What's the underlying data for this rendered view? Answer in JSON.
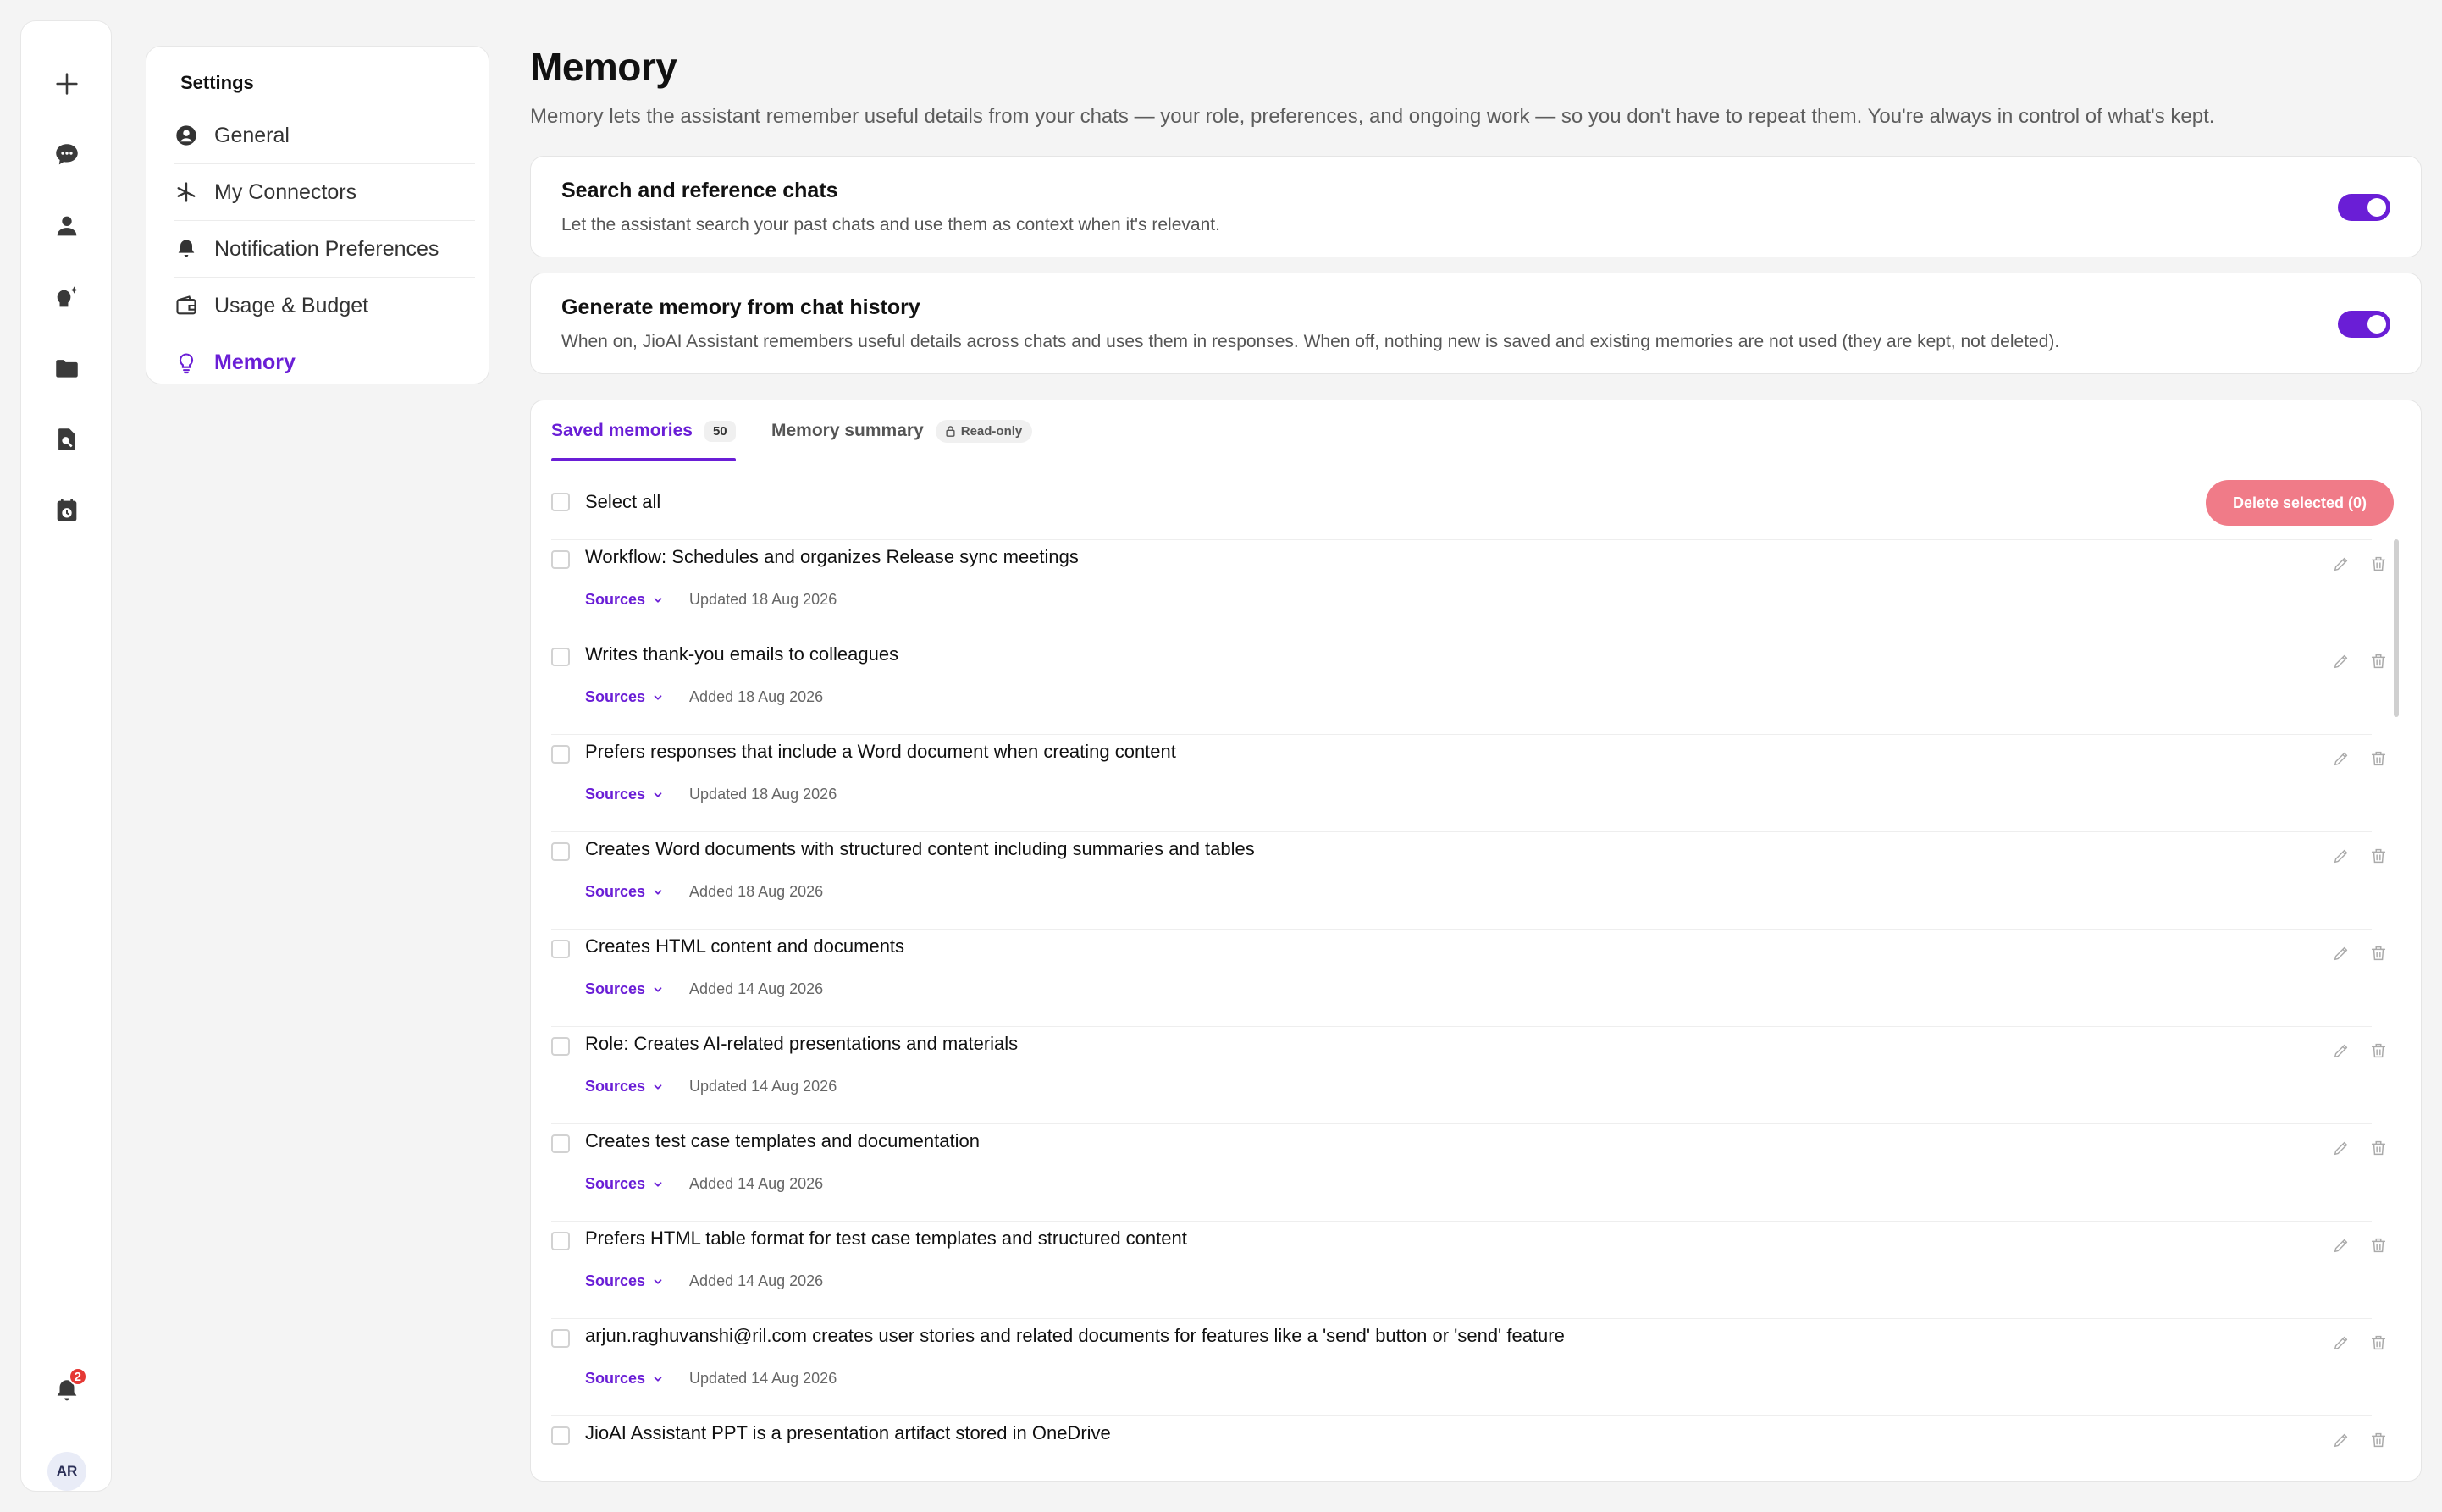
{
  "rail": {
    "icons": [
      "plus-icon",
      "chat-icon",
      "person-icon",
      "sparkle-bulb-icon",
      "folder-icon",
      "document-search-icon",
      "calendar-clock-icon"
    ],
    "notifications_count": "2",
    "avatar_initials": "AR"
  },
  "settings": {
    "title": "Settings",
    "items": [
      {
        "label": "General",
        "icon": "user-circle-icon"
      },
      {
        "label": "My Connectors",
        "icon": "connector-icon"
      },
      {
        "label": "Notification Preferences",
        "icon": "bell-icon"
      },
      {
        "label": "Usage & Budget",
        "icon": "wallet-icon"
      },
      {
        "label": "Memory",
        "icon": "lightbulb-icon",
        "active": true
      }
    ]
  },
  "main": {
    "title": "Memory",
    "description": "Memory lets the assistant remember useful details from your chats — your role, preferences, and ongoing work — so you don't have to repeat them. You're always in control of what's kept.",
    "toggles": [
      {
        "title": "Search and reference chats",
        "description": "Let the assistant search your past chats and use them as context when it's relevant.",
        "on": true
      },
      {
        "title": "Generate memory from chat history",
        "description": "When on, JioAI Assistant remembers useful details across chats and uses them in responses. When off, nothing new is saved and existing memories are not used (they are kept, not deleted).",
        "on": true
      }
    ],
    "tabs": {
      "saved_label": "Saved memories",
      "saved_count": "50",
      "summary_label": "Memory summary",
      "summary_badge": "Read-only"
    },
    "select_all_label": "Select all",
    "delete_selected_label": "Delete selected (0)",
    "sources_label": "Sources",
    "memories": [
      {
        "text": "Workflow: Schedules and organizes Release sync meetings",
        "date": "Updated 18 Aug 2026"
      },
      {
        "text": "Writes thank-you emails to colleagues",
        "date": "Added 18 Aug 2026"
      },
      {
        "text": "Prefers responses that include a Word document when creating content",
        "date": "Updated 18 Aug 2026"
      },
      {
        "text": "Creates Word documents with structured content including summaries and tables",
        "date": "Added 18 Aug 2026"
      },
      {
        "text": "Creates HTML content and documents",
        "date": "Added 14 Aug 2026"
      },
      {
        "text": "Role: Creates AI-related presentations and materials",
        "date": "Updated 14 Aug 2026"
      },
      {
        "text": "Creates test case templates and documentation",
        "date": "Added 14 Aug 2026"
      },
      {
        "text": "Prefers HTML table format for test case templates and structured content",
        "date": "Added 14 Aug 2026"
      },
      {
        "text": "arjun.raghuvanshi@ril.com creates user stories and related documents for features like a 'send' button or 'send' feature",
        "date": "Updated 14 Aug 2026"
      },
      {
        "text": "JioAI Assistant PPT is a presentation artifact stored in OneDrive",
        "date": ""
      }
    ]
  },
  "colors": {
    "accent": "#6a1ed6",
    "danger_soft": "#f07b88",
    "badge": "#e53935"
  }
}
